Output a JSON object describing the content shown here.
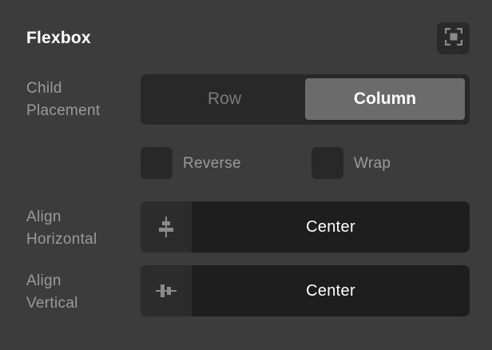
{
  "panel": {
    "title": "Flexbox",
    "focus_button_icon": "focus-frame-icon"
  },
  "child_placement": {
    "label_line1": "Child",
    "label_line2": "Placement",
    "options": [
      "Row",
      "Column"
    ],
    "selected": "Column"
  },
  "checkboxes": {
    "reverse_label": "Reverse",
    "reverse_checked": false,
    "wrap_label": "Wrap",
    "wrap_checked": false
  },
  "align_horizontal": {
    "label_line1": "Align",
    "label_line2": "Horizontal",
    "icon": "align-horizontal-center-icon",
    "value": "Center"
  },
  "align_vertical": {
    "label_line1": "Align",
    "label_line2": "Vertical",
    "icon": "align-vertical-center-icon",
    "value": "Center"
  },
  "colors": {
    "background": "#3c3c3c",
    "control_bg": "#282828",
    "selected_segment": "#6b6b6b",
    "label_text": "#9a9a9a"
  }
}
